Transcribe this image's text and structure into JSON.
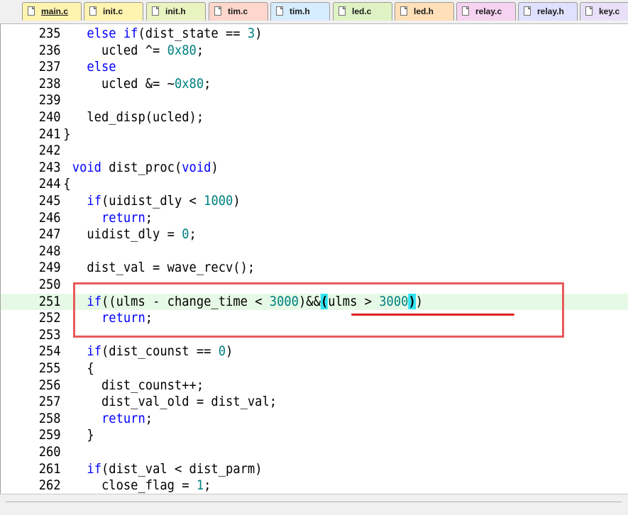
{
  "tabs": [
    {
      "label": "main.c",
      "color": "#fff3b0",
      "active": true
    },
    {
      "label": "init.c",
      "color": "#fff3b0",
      "active": false
    },
    {
      "label": "init.h",
      "color": "#e9f3c0",
      "active": false
    },
    {
      "label": "tim.c",
      "color": "#ffd6cc",
      "active": false
    },
    {
      "label": "tim.h",
      "color": "#d6ecff",
      "active": false
    },
    {
      "label": "led.c",
      "color": "#dff2c4",
      "active": false
    },
    {
      "label": "led.h",
      "color": "#ffe0b8",
      "active": false
    },
    {
      "label": "relay.c",
      "color": "#f6d3f0",
      "active": false
    },
    {
      "label": "relay.h",
      "color": "#e0e0ff",
      "active": false
    },
    {
      "label": "key.c",
      "color": "#e8e0f8",
      "active": false
    }
  ],
  "lines": [
    {
      "no": "235",
      "fold": "",
      "code": [
        {
          "t": "  "
        },
        {
          "t": "else if",
          "c": "kw"
        },
        {
          "t": "(dist_state == "
        },
        {
          "t": "3",
          "c": "num"
        },
        {
          "t": ")"
        }
      ]
    },
    {
      "no": "236",
      "fold": "",
      "code": [
        {
          "t": "    ucled ^= "
        },
        {
          "t": "0x80",
          "c": "num"
        },
        {
          "t": ";"
        }
      ]
    },
    {
      "no": "237",
      "fold": "",
      "code": [
        {
          "t": "  "
        },
        {
          "t": "else",
          "c": "kw"
        }
      ]
    },
    {
      "no": "238",
      "fold": "",
      "code": [
        {
          "t": "    ucled &= ~"
        },
        {
          "t": "0x80",
          "c": "num"
        },
        {
          "t": ";"
        }
      ]
    },
    {
      "no": "239",
      "fold": "",
      "code": []
    },
    {
      "no": "240",
      "fold": "",
      "code": [
        {
          "t": "  led_disp(ucled);"
        }
      ]
    },
    {
      "no": "241",
      "fold": "}",
      "code": []
    },
    {
      "no": "242",
      "fold": "",
      "code": []
    },
    {
      "no": "243",
      "fold": "",
      "code": [
        {
          "t": "void",
          "c": "kw"
        },
        {
          "t": " dist_proc("
        },
        {
          "t": "void",
          "c": "kw"
        },
        {
          "t": ")"
        }
      ]
    },
    {
      "no": "244",
      "fold": "{",
      "code": []
    },
    {
      "no": "245",
      "fold": "",
      "code": [
        {
          "t": "  "
        },
        {
          "t": "if",
          "c": "kw"
        },
        {
          "t": "(uidist_dly < "
        },
        {
          "t": "1000",
          "c": "num"
        },
        {
          "t": ")"
        }
      ]
    },
    {
      "no": "246",
      "fold": "",
      "code": [
        {
          "t": "    "
        },
        {
          "t": "return",
          "c": "kw"
        },
        {
          "t": ";"
        }
      ]
    },
    {
      "no": "247",
      "fold": "",
      "code": [
        {
          "t": "  uidist_dly = "
        },
        {
          "t": "0",
          "c": "num"
        },
        {
          "t": ";"
        }
      ]
    },
    {
      "no": "248",
      "fold": "",
      "code": []
    },
    {
      "no": "249",
      "fold": "",
      "code": [
        {
          "t": "  dist_val = wave_recv();"
        }
      ]
    },
    {
      "no": "250",
      "fold": "",
      "code": []
    },
    {
      "no": "251",
      "fold": "",
      "current": true,
      "code": [
        {
          "t": "  "
        },
        {
          "t": "if",
          "c": "kw"
        },
        {
          "t": "((ulms - change_time < "
        },
        {
          "t": "3000",
          "c": "num"
        },
        {
          "t": ")&&"
        },
        {
          "t": "(",
          "c": "brace-hl"
        },
        {
          "t": "ulms > "
        },
        {
          "t": "3000",
          "c": "num"
        },
        {
          "t": ")",
          "c": "brace-hl"
        },
        {
          "t": ")"
        }
      ]
    },
    {
      "no": "252",
      "fold": "",
      "code": [
        {
          "t": "    "
        },
        {
          "t": "return",
          "c": "kw"
        },
        {
          "t": ";"
        }
      ]
    },
    {
      "no": "253",
      "fold": "",
      "code": []
    },
    {
      "no": "254",
      "fold": "",
      "code": [
        {
          "t": "  "
        },
        {
          "t": "if",
          "c": "kw"
        },
        {
          "t": "(dist_counst == "
        },
        {
          "t": "0",
          "c": "num"
        },
        {
          "t": ")"
        }
      ]
    },
    {
      "no": "255",
      "fold": "",
      "code": [
        {
          "t": "  {"
        }
      ]
    },
    {
      "no": "256",
      "fold": "",
      "code": [
        {
          "t": "    dist_counst++;"
        }
      ]
    },
    {
      "no": "257",
      "fold": "",
      "code": [
        {
          "t": "    dist_val_old = dist_val;"
        }
      ]
    },
    {
      "no": "258",
      "fold": "",
      "code": [
        {
          "t": "    "
        },
        {
          "t": "return",
          "c": "kw"
        },
        {
          "t": ";"
        }
      ]
    },
    {
      "no": "259",
      "fold": "",
      "code": [
        {
          "t": "  }"
        }
      ]
    },
    {
      "no": "260",
      "fold": "",
      "code": []
    },
    {
      "no": "261",
      "fold": "",
      "code": [
        {
          "t": "  "
        },
        {
          "t": "if",
          "c": "kw"
        },
        {
          "t": "(dist_val < dist_parm)"
        }
      ]
    },
    {
      "no": "262",
      "fold": "",
      "code": [
        {
          "t": "    close_flag = "
        },
        {
          "t": "1",
          "c": "num"
        },
        {
          "t": ";"
        }
      ]
    }
  ]
}
